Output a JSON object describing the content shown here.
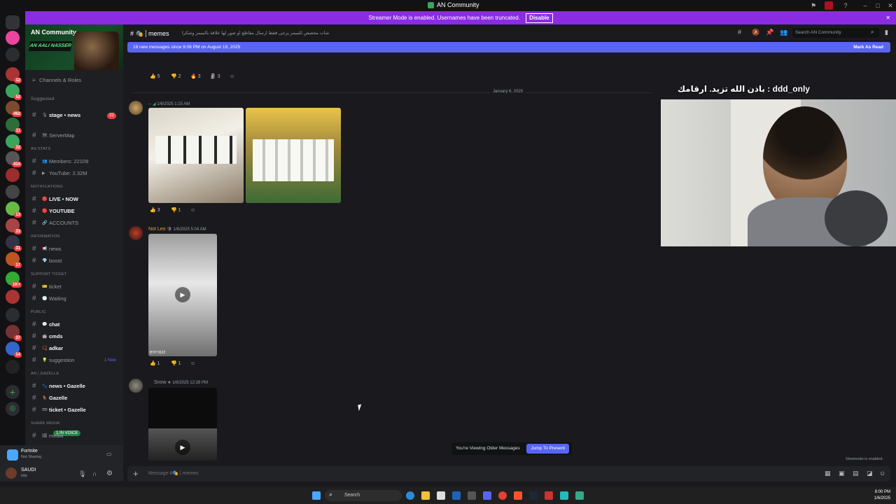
{
  "window": {
    "title": "AN Community"
  },
  "banner": {
    "text": "Streamer Mode is enabled. Usernames have been truncated.",
    "disable_label": "Disable"
  },
  "server": {
    "name": "AN Community",
    "banner_art": "AN AALI NASSER"
  },
  "channels_roles": "Channels & Roles",
  "suggested": "Suggested",
  "sidebar": {
    "items": [
      {
        "label": "stage • news",
        "count": "22",
        "bold": true
      },
      {
        "label": "ServerMap"
      },
      {
        "cat": "AN STATS"
      },
      {
        "label": "Members: 22109"
      },
      {
        "label": "YouTube: 2.32M"
      },
      {
        "cat": "NOTIFICATIONS"
      },
      {
        "label": "LIVE • NOW",
        "bold": true
      },
      {
        "label": "YOUTUBE",
        "bold": true
      },
      {
        "label": "ACCOUNTS"
      },
      {
        "cat": "INFORMATION"
      },
      {
        "label": "news"
      },
      {
        "label": "boost"
      },
      {
        "cat": "SUPPORT TICKET"
      },
      {
        "label": "ticket"
      },
      {
        "label": "Waiting"
      },
      {
        "cat": "PUBLIC"
      },
      {
        "label": "chat",
        "bold": true
      },
      {
        "label": "cmds",
        "bold": true
      },
      {
        "label": "adkar",
        "bold": true
      },
      {
        "label": "suggestion",
        "new": "1 New"
      },
      {
        "cat": "AN | GAZELLE"
      },
      {
        "label": "news • Gazelle",
        "bold": true
      },
      {
        "label": "Gazelle",
        "bold": true
      },
      {
        "label": "ticket • Gazelle",
        "bold": true
      },
      {
        "cat": "SHARE MEDIA"
      },
      {
        "label": "media"
      }
    ]
  },
  "voice_pill": "1 IN VOICE",
  "activity": {
    "game": "Fortnite",
    "status": "Not Sharing"
  },
  "user": {
    "name": "SAUDI",
    "status": "Idle"
  },
  "header": {
    "channel": "memes",
    "topic": "شات مخصص للميمز يرجى فقط ارسال مقاطع او صور لها علاقة بالميمز وشكرا",
    "search_placeholder": "Search AN Community"
  },
  "newbar": {
    "text": "19 new messages since 9:06 PM on August 19, 2025",
    "mark": "Mark As Read"
  },
  "date_divider": "January 6, 2025",
  "messages": [
    {
      "author": "",
      "time": "1/6/2025 1:15 AM",
      "reactions": [
        "3",
        "1"
      ]
    },
    {
      "author": "Not Leo",
      "time": "1/6/2025 5:04 AM",
      "reactions": [
        "1",
        "1"
      ],
      "video_caption": "BTP 5522"
    },
    {
      "author": "Snow",
      "time": "1/6/2025 12:28 PM"
    }
  ],
  "top_reactions": [
    "5",
    "2",
    "3",
    "3"
  ],
  "webcam": {
    "label": "باذن الله تزيد. ارقامك : ddd_only"
  },
  "older": {
    "text": "You're Viewing Older Messages",
    "jump": "Jump To Present"
  },
  "slowmode": "Slowmode is enabled.",
  "composer": {
    "placeholder": "Message #🎭 ⸽ memes"
  },
  "taskbar": {
    "search": "Search",
    "time": "8:00 PM",
    "date": "1/6/2025"
  }
}
